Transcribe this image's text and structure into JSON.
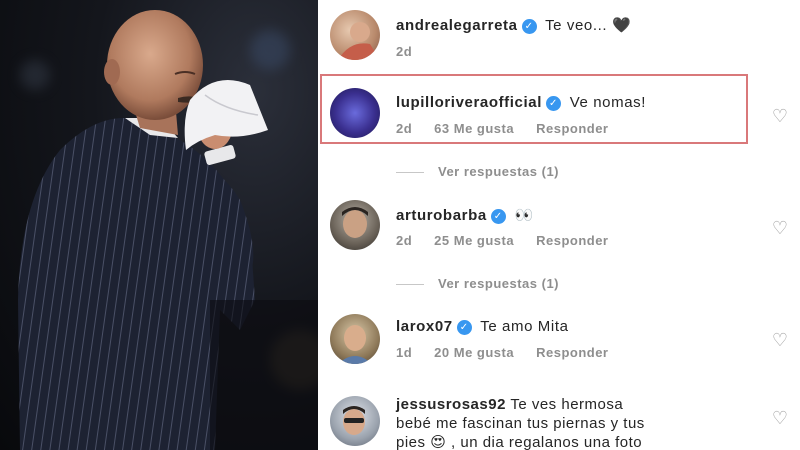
{
  "comments": [
    {
      "username": "andrealegarreta",
      "verified": true,
      "text": "Te veo...",
      "emoji": "🖤",
      "age": "2d"
    },
    {
      "username": "lupilloriveraofficial",
      "verified": true,
      "text": "Ve nomas!",
      "age": "2d",
      "likes": "63 Me gusta",
      "reply": "Responder",
      "view_replies": "Ver respuestas (1)"
    },
    {
      "username": "arturobarba",
      "verified": true,
      "emoji": "👀",
      "age": "2d",
      "likes": "25 Me gusta",
      "reply": "Responder",
      "view_replies": "Ver respuestas (1)"
    },
    {
      "username": "larox07",
      "verified": true,
      "text": "Te amo Mita",
      "age": "1d",
      "likes": "20 Me gusta",
      "reply": "Responder"
    },
    {
      "username": "jessusrosas92",
      "text_a": "Te ves hermosa",
      "text_b": "bebé me fascinan tus piernas y tus",
      "text_c": "pies",
      "emoji": "😍",
      "text_d": ", un dia regalanos una foto"
    }
  ],
  "icons": {
    "verified": "verified-badge-icon",
    "like": "heart-outline-icon"
  },
  "colors": {
    "verified": "#3897f0",
    "highlight_border": "#d9787a",
    "meta_text": "#8e8e8e"
  }
}
